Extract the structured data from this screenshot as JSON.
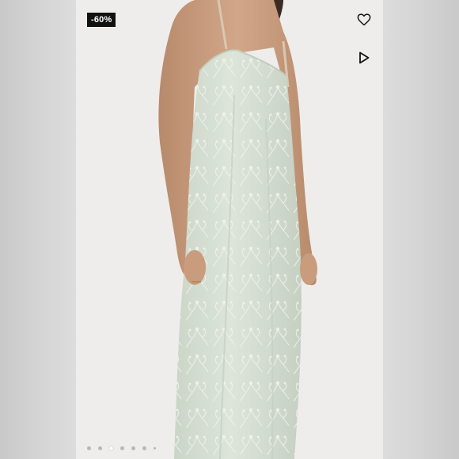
{
  "listing": {
    "discount_badge": "-60%",
    "icons": {
      "favorite": "heart-icon",
      "video": "play-icon"
    },
    "carousel": {
      "total_dots": 7,
      "active_index": 2
    },
    "colors": {
      "dress": "#d9e2d6",
      "background": "#eeedec",
      "badge": "#111111"
    }
  }
}
